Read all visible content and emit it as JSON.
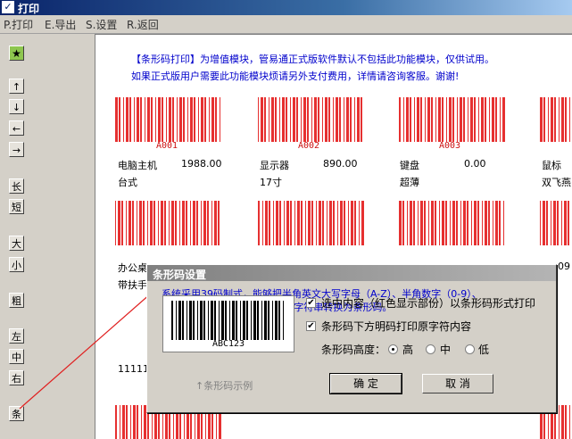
{
  "window": {
    "title": "打印"
  },
  "menu": [
    {
      "label": "P.打印"
    },
    {
      "label": "E.导出"
    },
    {
      "label": "S.设置"
    },
    {
      "label": "R.返回"
    }
  ],
  "toolbar": {
    "star": "★",
    "up": "↑",
    "down": "↓",
    "left": "←",
    "right": "→",
    "long": "长",
    "short": "短",
    "big": "大",
    "small": "小",
    "bold": "粗",
    "align_left": "左",
    "align_center": "中",
    "align_right": "右",
    "barcode": "条"
  },
  "notice": {
    "line1": "【条形码打印】为增值模块，管易通正式版软件默认不包括此功能模块，仅供试用。",
    "line2": "如果正式版用户需要此功能模块烦请另外支付费用，详情请咨询客服。谢谢!"
  },
  "items": [
    {
      "code": "A001",
      "name": "电脑主机",
      "price": "1988.00",
      "spec": "台式"
    },
    {
      "code": "A002",
      "name": "显示器",
      "price": "890.00",
      "spec": "17寸"
    },
    {
      "code": "A003",
      "name": "键盘",
      "price": "0.00",
      "spec": "超薄"
    },
    {
      "code": "",
      "name": "鼠标",
      "price": "",
      "spec": "双飞燕"
    }
  ],
  "row2": {
    "left_line1": "办公桌",
    "left_line2": "带扶手",
    "right_fragment": "09"
  },
  "row3": {
    "left": "11111"
  },
  "dialog": {
    "title": "条形码设置",
    "desc_line1": "系统采用39码制式，能够把半角英文大写字母（A-Z）、半角数字（0-9）、",
    "desc_line2": "以及五个符号（+-/.$）组成的字符串转换为条形码。",
    "sample_code": "ABC123",
    "opt1": "选中内容（红色显示部份）以条形码形式打印",
    "opt1_checked": "✔",
    "opt2": "条形码下方明码打印原字符内容",
    "opt2_checked": "✔",
    "height_label": "条形码高度：",
    "height_options": [
      "高",
      "中",
      "低"
    ],
    "height_selected": "高",
    "hint": "↑条形码示例",
    "ok": "确 定",
    "cancel": "取 消"
  },
  "colors": {
    "barcode_red": "#e63030",
    "notice_blue": "#0000cc",
    "accent_arrow": "#e02020"
  }
}
